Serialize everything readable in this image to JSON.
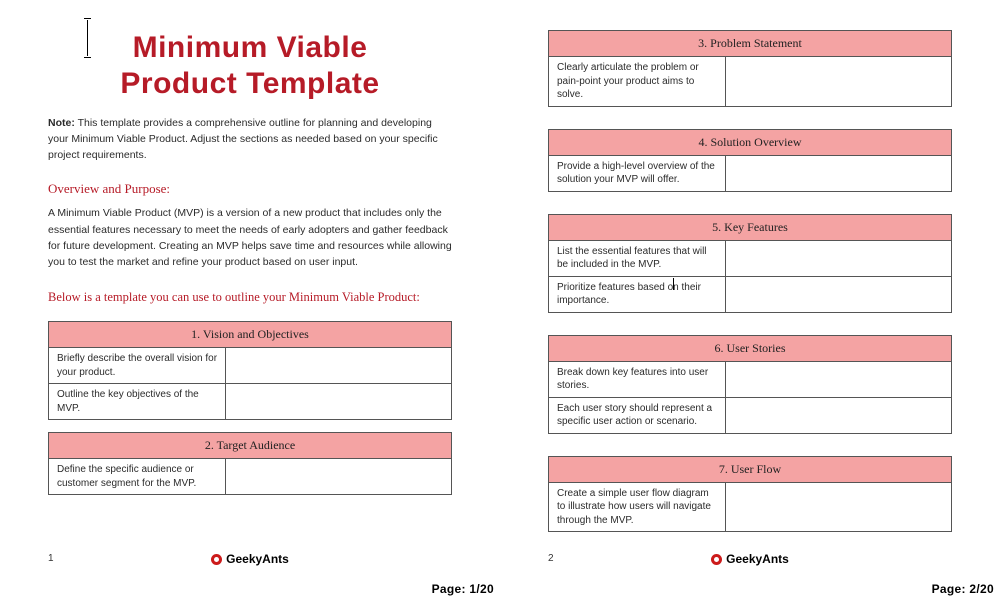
{
  "title_line1": "Minimum Viable",
  "title_line2": "Product Template",
  "note_label": "Note:",
  "note_text": " This template provides a comprehensive outline for planning and developing your Minimum Viable Product. Adjust the sections as needed based on your specific project requirements.",
  "overview_heading": "Overview and Purpose:",
  "overview_body": "A Minimum Viable Product (MVP) is a version of a new product that includes only the essential features necessary to meet the needs of early adopters and gather feedback for future development. Creating an MVP helps save time and resources while allowing you to test the market and refine your product based on user input.",
  "subhead": "Below is a template you can use to outline your Minimum Viable Product:",
  "sections": [
    {
      "title": "1. Vision and Objectives",
      "rows": [
        "Briefly describe the overall vision for your product.",
        "Outline the key objectives of the MVP."
      ]
    },
    {
      "title": "2. Target Audience",
      "rows": [
        "Define the specific audience or customer segment for the MVP."
      ]
    },
    {
      "title": "3. Problem Statement",
      "rows": [
        "Clearly articulate the problem or pain-point your product aims to solve."
      ]
    },
    {
      "title": "4. Solution Overview",
      "rows": [
        "Provide a high-level overview of the solution your MVP will offer."
      ]
    },
    {
      "title": "5. Key Features",
      "rows": [
        "List the essential features that will be included in the MVP.",
        "Prioritize features based on their importance."
      ]
    },
    {
      "title": "6. User Stories",
      "rows": [
        "Break down key features into user stories.",
        "Each user story should represent a specific user action or scenario."
      ]
    },
    {
      "title": "7. User Flow",
      "rows": [
        "Create a simple user flow diagram to illustrate how users will navigate through the MVP."
      ]
    }
  ],
  "brand": "GeekyAnts",
  "page1_num": "1",
  "page2_num": "2",
  "overlay1": "Page: 1/20",
  "overlay2": "Page: 2/20"
}
